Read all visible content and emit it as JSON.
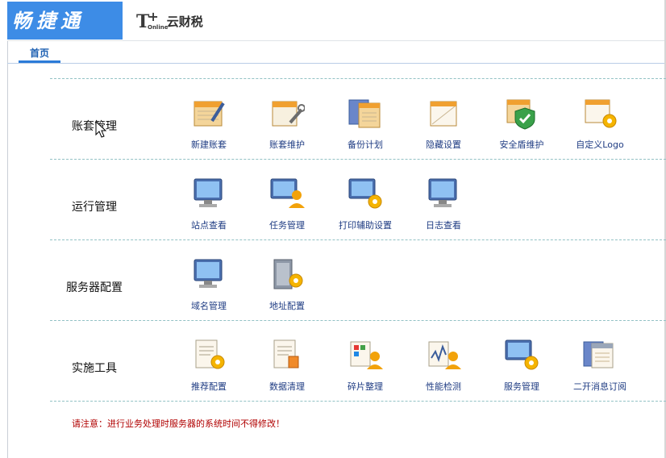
{
  "header": {
    "brand": "畅捷通",
    "logo_mark": "T",
    "logo_plus": "+",
    "logo_sub": "Online",
    "logo_name": "云财税"
  },
  "tabs": [
    {
      "label": "首页"
    }
  ],
  "sections": [
    {
      "title": "账套管理",
      "items": [
        {
          "label": "新建账套",
          "icon": "ledger-pen-icon"
        },
        {
          "label": "账套维护",
          "icon": "ledger-wrench-icon"
        },
        {
          "label": "备份计划",
          "icon": "ledger-backup-icon"
        },
        {
          "label": "隐藏设置",
          "icon": "ledger-hide-icon"
        },
        {
          "label": "安全盾维护",
          "icon": "ledger-shield-icon"
        },
        {
          "label": "自定义Logo",
          "icon": "ledger-logo-gear-icon"
        }
      ]
    },
    {
      "title": "运行管理",
      "items": [
        {
          "label": "站点查看",
          "icon": "monitor-icon"
        },
        {
          "label": "任务管理",
          "icon": "monitor-user-icon"
        },
        {
          "label": "打印辅助设置",
          "icon": "monitor-gear-icon"
        },
        {
          "label": "日志查看",
          "icon": "monitor-icon"
        }
      ]
    },
    {
      "title": "服务器配置",
      "items": [
        {
          "label": "域名管理",
          "icon": "monitor-icon"
        },
        {
          "label": "地址配置",
          "icon": "server-gear-icon"
        }
      ]
    },
    {
      "title": "实施工具",
      "items": [
        {
          "label": "推荐配置",
          "icon": "document-gear-icon"
        },
        {
          "label": "数据清理",
          "icon": "document-edit-icon"
        },
        {
          "label": "碎片整理",
          "icon": "fragment-user-icon"
        },
        {
          "label": "性能检测",
          "icon": "chart-user-icon"
        },
        {
          "label": "服务管理",
          "icon": "monitor-gear-icon"
        },
        {
          "label": "二开消息订阅",
          "icon": "ledger-stack-icon"
        }
      ]
    }
  ],
  "notice": "请注意：进行业务处理时服务器的系统时间不得修改！",
  "colors": {
    "brand_bg": "#3d8ce6",
    "link": "#1f3c83",
    "tab": "#1c5fb2",
    "notice": "#b00000",
    "divider": "#93c2c5"
  }
}
